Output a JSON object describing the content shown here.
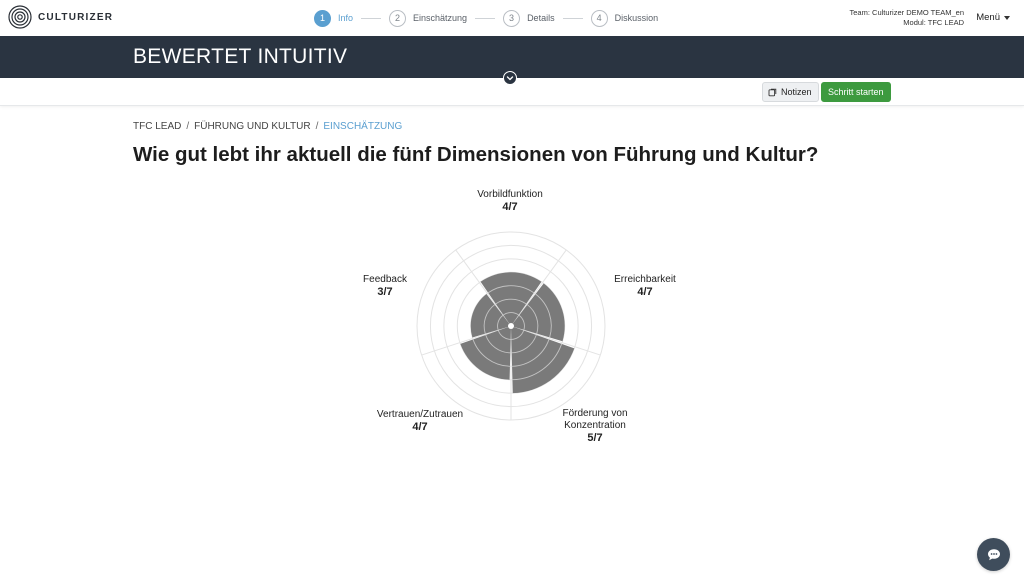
{
  "header": {
    "logo_text": "CULTURIZER",
    "steps": [
      {
        "num": "1",
        "label": "Info",
        "active": true
      },
      {
        "num": "2",
        "label": "Einschätzung",
        "active": false
      },
      {
        "num": "3",
        "label": "Details",
        "active": false
      },
      {
        "num": "4",
        "label": "Diskussion",
        "active": false
      }
    ],
    "team_line": "Team: Culturizer DEMO TEAM_en",
    "module_line": "Modul: TFC LEAD",
    "menu_label": "Menü"
  },
  "band": {
    "title": "BEWERTET INTUITIV"
  },
  "actions": {
    "notes_label": "Notizen",
    "start_label": "Schritt starten"
  },
  "breadcrumb": {
    "items": [
      "TFC LEAD",
      "FÜHRUNG UND KULTUR",
      "EINSCHÄTZUNG"
    ]
  },
  "question": "Wie gut lebt ihr aktuell die fünf Dimensionen von Führung und Kultur?",
  "chart_data": {
    "type": "polar-bar",
    "max": 7,
    "ring_count": 7,
    "fill_color": "#7a7a7a",
    "grid_color": "#e3e3e3",
    "dimensions": [
      {
        "name": "Vorbildfunktion",
        "score": 4,
        "score_label": "4/7"
      },
      {
        "name": "Erreichbarkeit",
        "score": 4,
        "score_label": "4/7"
      },
      {
        "name": "Förderung von Konzentration",
        "score": 5,
        "score_label": "5/7"
      },
      {
        "name": "Vertrauen/Zutrauen",
        "score": 4,
        "score_label": "4/7"
      },
      {
        "name": "Feedback",
        "score": 3,
        "score_label": "3/7"
      }
    ]
  },
  "icons": {
    "toggle": "chevron-down-icon",
    "notes": "notes-icon",
    "chat": "chat-icon",
    "menu_caret": "caret-down-icon"
  },
  "colors": {
    "accent": "#5a9fd0",
    "band": "#2a3441",
    "primary_button": "#3d9a3f"
  }
}
